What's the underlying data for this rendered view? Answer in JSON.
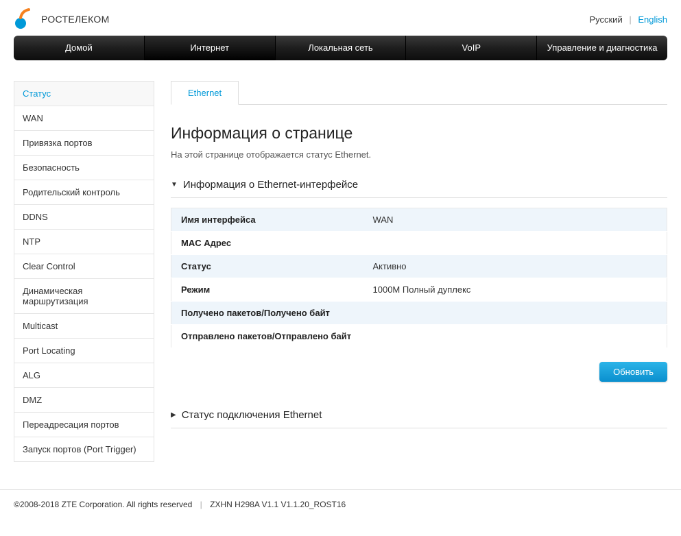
{
  "brand": {
    "name": "Ростелеком"
  },
  "lang": {
    "ru": "Русский",
    "en": "English",
    "sep": "|"
  },
  "nav": {
    "items": [
      {
        "label": "Домой"
      },
      {
        "label": "Интернет"
      },
      {
        "label": "Локальная сеть"
      },
      {
        "label": "VoIP"
      },
      {
        "label": "Управление и диагностика"
      }
    ]
  },
  "sidebar": {
    "items": [
      {
        "label": "Статус"
      },
      {
        "label": "WAN"
      },
      {
        "label": "Привязка портов"
      },
      {
        "label": "Безопасность"
      },
      {
        "label": "Родительский контроль"
      },
      {
        "label": "DDNS"
      },
      {
        "label": "NTP"
      },
      {
        "label": "Clear Control"
      },
      {
        "label": "Динамическая маршрутизация"
      },
      {
        "label": "Multicast"
      },
      {
        "label": "Port Locating"
      },
      {
        "label": "ALG"
      },
      {
        "label": "DMZ"
      },
      {
        "label": "Переадресация портов"
      },
      {
        "label": "Запуск портов (Port Trigger)"
      }
    ]
  },
  "tabs": {
    "ethernet": "Ethernet"
  },
  "page": {
    "title": "Информация о странице",
    "desc": "На этой странице отображается статус Ethernet."
  },
  "section1": {
    "title": "Информация о Ethernet-интерфейсе",
    "rows": [
      {
        "key": "Имя интерфейса",
        "val": "WAN"
      },
      {
        "key": "MAC Адрес",
        "val": ""
      },
      {
        "key": "Статус",
        "val": "Активно"
      },
      {
        "key": "Режим",
        "val": "1000M Полный дуплекс"
      },
      {
        "key": "Получено пакетов/Получено байт",
        "val": ""
      },
      {
        "key": "Отправлено пакетов/Отправлено байт",
        "val": ""
      }
    ]
  },
  "section2": {
    "title": "Статус подключения Ethernet"
  },
  "buttons": {
    "refresh": "Обновить"
  },
  "footer": {
    "copyright": "©2008-2018 ZTE Corporation. All rights reserved",
    "sep": "|",
    "model": "ZXHN H298A V1.1 V1.1.20_ROST16"
  }
}
